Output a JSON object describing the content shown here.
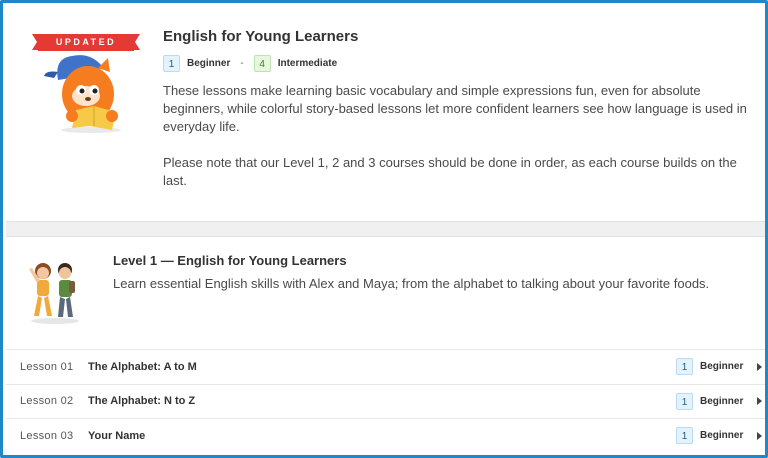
{
  "course": {
    "badge": "UPDATED",
    "title": "English for Young Learners",
    "level_from": {
      "number": "1",
      "label": "Beginner"
    },
    "separator": "-",
    "level_to": {
      "number": "4",
      "label": "Intermediate"
    },
    "description_1": "These lessons make learning basic vocabulary and simple expressions fun, even for absolute beginners, while colorful story-based lessons let more confident learners see how language is used in everyday life.",
    "description_2": "Please note that our Level 1, 2 and 3 courses should be done in order, as each course builds on the last."
  },
  "level": {
    "title": "Level 1 — English for Young Learners",
    "description": "Learn essential English skills with Alex and Maya; from the alphabet to talking about your favorite foods."
  },
  "lessons": [
    {
      "number": "Lesson 01",
      "name": "The Alphabet: A to M",
      "level_number": "1",
      "level_label": "Beginner"
    },
    {
      "number": "Lesson 02",
      "name": "The Alphabet: N to Z",
      "level_number": "1",
      "level_label": "Beginner"
    },
    {
      "number": "Lesson 03",
      "name": "Your Name",
      "level_number": "1",
      "level_label": "Beginner"
    }
  ],
  "colors": {
    "frame": "#1e88c8",
    "badge": "#e53935",
    "beginner": "#e3f2fb",
    "intermediate": "#e7f6df",
    "mascot": "#f57c1f"
  },
  "icons": {
    "course_image": "fox-mascot-with-cap-and-book",
    "level_image": "two-children-characters",
    "row_arrow": "chevron-right-icon"
  }
}
